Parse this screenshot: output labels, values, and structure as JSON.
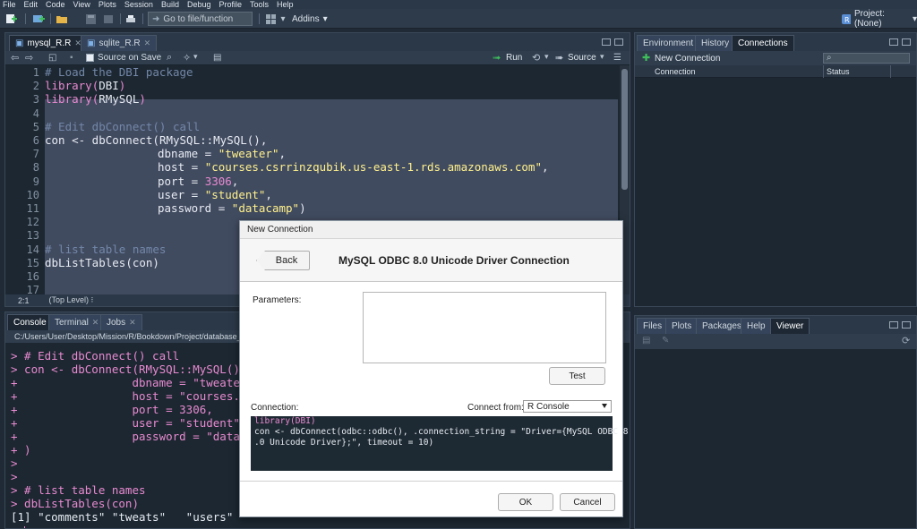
{
  "menu": [
    "File",
    "Edit",
    "Code",
    "View",
    "Plots",
    "Session",
    "Build",
    "Debug",
    "Profile",
    "Tools",
    "Help"
  ],
  "toolbar": {
    "goto_placeholder": "Go to file/function",
    "addins_label": "Addins",
    "project_label": "Project: (None)"
  },
  "source": {
    "tabs": [
      {
        "label": "mysql_R.R"
      },
      {
        "label": "sqlite_R.R"
      }
    ],
    "source_on_save_label": "Source on Save",
    "run_label": "Run",
    "source_label": "Source",
    "line_numbers": [
      "1",
      "2",
      "3",
      "4",
      "5",
      "6",
      "7",
      "8",
      "9",
      "10",
      "11",
      "12",
      "13",
      "14",
      "15",
      "16",
      "17"
    ],
    "status_position": "2:1",
    "status_scope": "(Top Level)"
  },
  "code": {
    "l1": "# Load the DBI package",
    "l2_fn": "library",
    "l2_arg": "DBI",
    "l3_fn": "library",
    "l3_arg": "RMySQL",
    "l5": "# Edit dbConnect() call",
    "l6_a": "con <- dbConnect(",
    "l6_b": "RMySQL::MySQL()",
    "l6_c": ",",
    "l7_key": "dbname = ",
    "l7_val": "\"tweater\"",
    "l8_key": "host = ",
    "l8_val": "\"courses.csrrinzqubik.us-east-1.rds.amazonaws.com\"",
    "l9_key": "port = ",
    "l9_val": "3306",
    "l10_key": "user = ",
    "l10_val": "\"student\"",
    "l11_key": "password = ",
    "l11_val": "\"datacamp\"",
    "l14": "# list table names",
    "l15_fn": "dbListTables",
    "l15_arg": "con"
  },
  "console": {
    "tabs": [
      {
        "label": "Console"
      },
      {
        "label": "Terminal"
      },
      {
        "label": "Jobs"
      }
    ],
    "path": "C:/Users/User/Desktop/Mission/R/Bookdown/Project/database_c",
    "lines": {
      "c1": "> # Edit dbConnect() call",
      "c2": "> con <- dbConnect(RMySQL::MySQL(),",
      "c3": "+                 dbname = \"tweater\"",
      "c4": "+                 host = \"courses.cs",
      "c5": "+                 port = 3306,",
      "c6": "+                 user = \"student\",",
      "c7": "+                 password = \"datac",
      "c8": "+ )",
      "c9": ">",
      "c10": ">",
      "c11": "> # list table names",
      "c12": "> dbListTables(con)",
      "c13": "[1] \"comments\" \"tweats\"   \"users\"",
      "c14": ">"
    }
  },
  "env": {
    "tabs": [
      {
        "label": "Environment"
      },
      {
        "label": "History"
      },
      {
        "label": "Connections"
      }
    ],
    "new_connection_label": "New Connection",
    "col_connection": "Connection",
    "col_status": "Status"
  },
  "files": {
    "tabs": [
      {
        "label": "Files"
      },
      {
        "label": "Plots"
      },
      {
        "label": "Packages"
      },
      {
        "label": "Help"
      },
      {
        "label": "Viewer"
      }
    ]
  },
  "dialog": {
    "window_title": "New Connection",
    "back_label": "Back",
    "title": "MySQL ODBC 8.0 Unicode Driver Connection",
    "parameters_label": "Parameters:",
    "test_label": "Test",
    "connection_label": "Connection:",
    "connect_from_label": "Connect from:",
    "connect_from_value": "R Console",
    "code_line1": "library(DBI)",
    "code_line2": "con <- dbConnect(odbc::odbc(), .connection_string = \"Driver={MySQL ODBC 8",
    "code_line3": ".0 Unicode Driver};\", timeout = 10)",
    "ok_label": "OK",
    "cancel_label": "Cancel"
  },
  "colors": {
    "accent_pink": "#e88ad0",
    "string_yellow": "#fff18c",
    "comment_blue": "#7387a8",
    "editor_bg": "#1c2731"
  }
}
